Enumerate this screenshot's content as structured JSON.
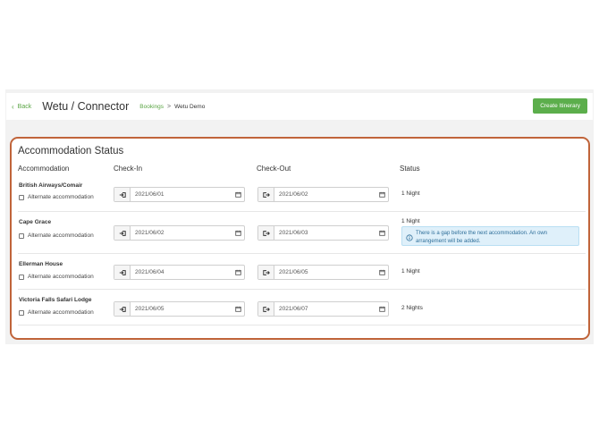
{
  "header": {
    "back_label": "Back",
    "title": "Wetu / Connector",
    "breadcrumb_link": "Bookings",
    "breadcrumb_sep": ">",
    "breadcrumb_current": "Wetu Demo",
    "create_label": "Create Itinerary"
  },
  "panel": {
    "title": "Accommodation Status",
    "columns": {
      "accommodation": "Accommodation",
      "checkin": "Check-In",
      "checkout": "Check-Out",
      "status": "Status"
    },
    "alt_label": "Alternate accommodation",
    "rows": [
      {
        "name": "British Airways/Comair",
        "checkin": "2021/06/01",
        "checkout": "2021/06/02",
        "status": "1 Night"
      },
      {
        "name": "Cape Grace",
        "checkin": "2021/06/02",
        "checkout": "2021/06/03",
        "status": "1 Night",
        "alert": "There is a gap before the next accommodation. An own arrangement will be added."
      },
      {
        "name": "Ellerman House",
        "checkin": "2021/06/04",
        "checkout": "2021/06/05",
        "status": "1 Night"
      },
      {
        "name": "Victoria Falls Safari Lodge",
        "checkin": "2021/06/05",
        "checkout": "2021/06/07",
        "status": "2 Nights"
      }
    ]
  },
  "colors": {
    "accent_green": "#5cae4c",
    "panel_border": "#c0643a",
    "alert_bg": "#dff0fa",
    "alert_text": "#2f6f9a"
  }
}
